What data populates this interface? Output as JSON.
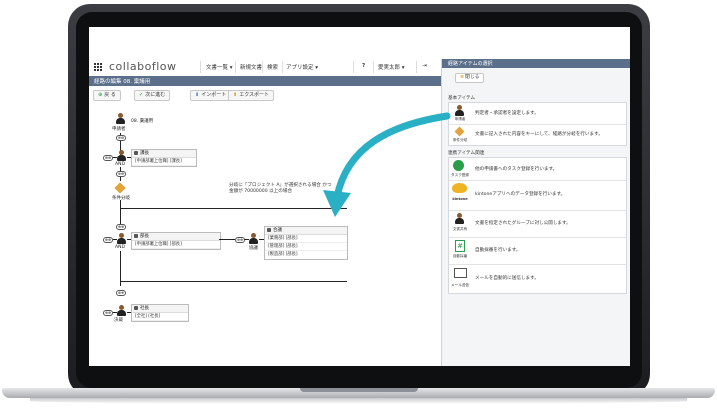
{
  "app": {
    "logo": "collaboflow",
    "nav": [
      "文書一覧 ▾",
      "新規文書",
      "検索",
      "アプリ設定 ▾",
      "?",
      "愛実太郎 ▾",
      "⇥"
    ],
    "page_title": "経路の編集  08. 稟議用"
  },
  "toolbar": {
    "back_label": "戻 る",
    "apply_label": "次に進む",
    "import_label": "インポート",
    "export_label": "エクスポート"
  },
  "flow": {
    "start_label": "申請者",
    "start_badge": "",
    "start_title": "08. 稟議用",
    "and1_label": "AND",
    "box1_title": "課長",
    "box1_row": "[申請部署上位職] [課長]",
    "cond_label": "条件分岐",
    "cond_text_1": "分岐に「プロジェクト A」が選択される場合 かつ",
    "cond_text_2": "金額が 70000000 以上の場合",
    "and2_label": "AND",
    "box2_title": "部長",
    "box2_row": "[申請部署上位職] [部長]",
    "merge_label": "協議",
    "box3_title": "合議",
    "box3_rows": [
      "[業務部] [部長]",
      "[管理部] [部長]",
      "[製造部] [部長]"
    ],
    "final_label": "決裁",
    "box4_title": "社長",
    "box4_row": "[全社] [社長]"
  },
  "panel": {
    "title": "経路アイテムの選択",
    "close_label": "閉じる",
    "basic_title": "基本アイテム",
    "basic_items": [
      {
        "caption": "申請者",
        "desc": "判定者・承認者を設定します。"
      },
      {
        "caption": "条件分岐",
        "desc": "文書に記入された内容をキーにして、経路が分岐を行います。"
      }
    ],
    "link_title": "連携アイテム関連",
    "link_items": [
      {
        "caption": "タスク登録",
        "desc": "他の申請書へのタスク登録を行います。"
      },
      {
        "caption": "kintone",
        "desc": "kintoneアプリへのデータ登録を行います。"
      },
      {
        "caption": "文書共有",
        "desc": "文書を指定されたグループに対し公開します。"
      },
      {
        "caption": "自動採番",
        "desc": "自動採番を行います。"
      },
      {
        "caption": "メール送信",
        "desc": "メールを自動的に送信します。"
      }
    ]
  },
  "colors": {
    "accent": "#2ab0c5",
    "header": "#5b6f8a",
    "orange": "#e3a33a"
  }
}
